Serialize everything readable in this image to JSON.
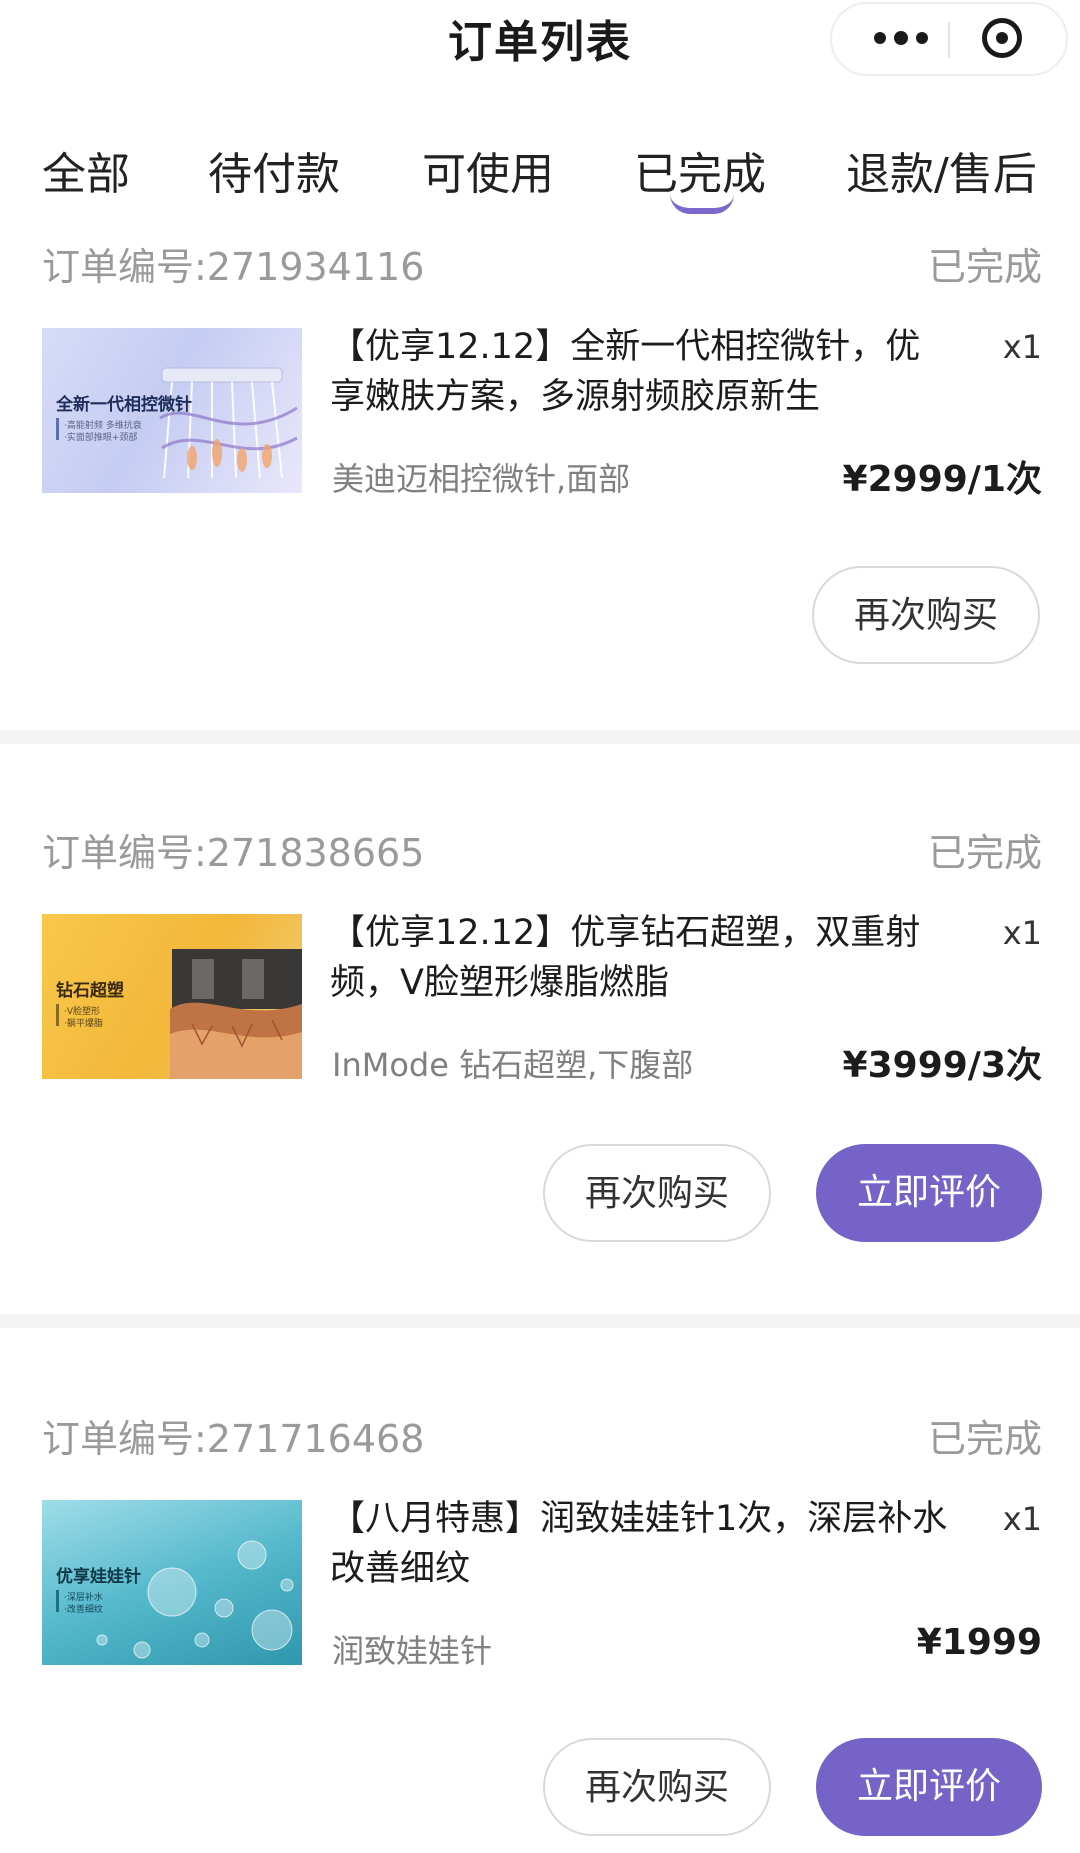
{
  "header": {
    "title": "订单列表"
  },
  "tabs": [
    {
      "label": "全部"
    },
    {
      "label": "待付款"
    },
    {
      "label": "可使用"
    },
    {
      "label": "已完成"
    },
    {
      "label": "退款/售后"
    }
  ],
  "active_tab": "已完成",
  "colors": {
    "accent": "#7563c7",
    "muted_text": "#9a9a9a"
  },
  "orders": [
    {
      "order_no": "订单编号:271934116",
      "status": "已完成",
      "thumb": {
        "title": "全新一代相控微针",
        "sub1": "·高能射频 多维抗衰",
        "sub2": "·实面部推眼+颈部"
      },
      "title": "【优享12.12】全新一代相控微针，优享嫩肤方案，多源射频胶原新生",
      "qty": "x1",
      "spec": "美迪迈相控微针,面部",
      "price": "¥2999/1次",
      "buttons": {
        "rebuy": "再次购买"
      }
    },
    {
      "order_no": "订单编号:271838665",
      "status": "已完成",
      "thumb": {
        "title": "钻石超塑",
        "sub1": "·V脸塑形",
        "sub2": "·躺平爆脂"
      },
      "title": "【优享12.12】优享钻石超塑，双重射频，V脸塑形爆脂燃脂",
      "qty": "x1",
      "spec": "InMode 钻石超塑,下腹部",
      "price": "¥3999/3次",
      "buttons": {
        "rebuy": "再次购买",
        "review": "立即评价"
      }
    },
    {
      "order_no": "订单编号:271716468",
      "status": "已完成",
      "thumb": {
        "title": "优享娃娃针",
        "sub1": "·深层补水",
        "sub2": "·改善细纹"
      },
      "title": "【八月特惠】润致娃娃针1次，深层补水改善细纹",
      "qty": "x1",
      "spec": "润致娃娃针",
      "price": "¥1999",
      "buttons": {
        "rebuy": "再次购买",
        "review": "立即评价"
      }
    }
  ]
}
